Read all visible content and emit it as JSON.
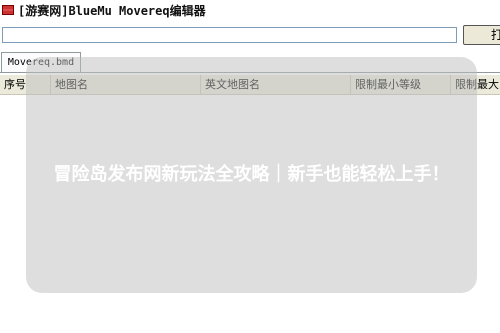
{
  "window": {
    "title": "[游赛网]BlueMu Movereq编辑器"
  },
  "toolbar": {
    "path_value": "",
    "open_label": "打"
  },
  "tabs": [
    {
      "label": "Movereq.bmd"
    }
  ],
  "grid": {
    "columns": [
      "序号",
      "地图名",
      "英文地图名",
      "限制最小等级",
      "限制最大"
    ]
  },
  "overlay": {
    "text": "冒险岛发布网新玩法全攻略｜新手也能轻松上手！"
  }
}
